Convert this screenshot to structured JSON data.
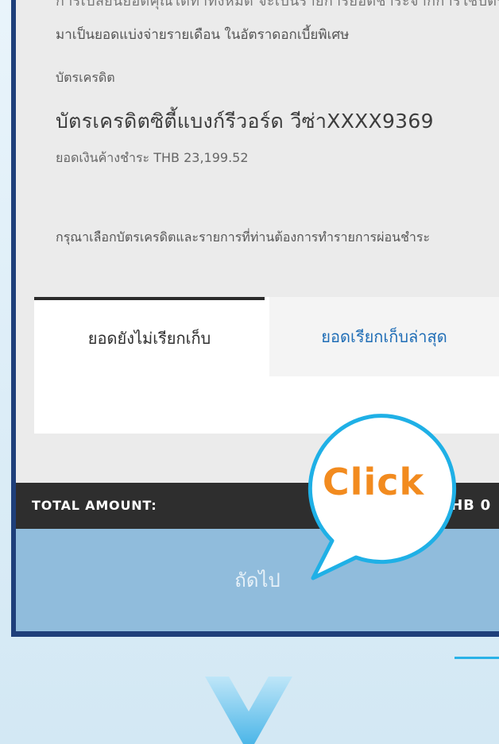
{
  "intro": {
    "cut_line_text": "การเปลี่ยนยอดคุณได้ทำทั้งหมด จะเป็นรายการยอดชำระจากการใช้บัตร",
    "description_text": "มาเป็นยอดแบ่งจ่ายรายเดือน ในอัตราดอกเบี้ยพิเศษ"
  },
  "card_section": {
    "label": "บัตรเครดิต",
    "card_name": "บัตรเครดิตซิตี้แบงก์รีวอร์ด วีซ่าXXXX9369",
    "balance_text": "ยอดเงินค้างชำระ THB 23,199.52"
  },
  "instruction_text": "กรุณาเลือกบัตรเครดิตและรายการที่ท่านต้องการทำรายการผ่อนชำระ",
  "tabs": [
    {
      "label": "ยอดยังไม่เรียกเก็บ",
      "active": true
    },
    {
      "label": "ยอดเรียกเก็บล่าสุด",
      "active": false
    }
  ],
  "total": {
    "label": "TOTAL AMOUNT:",
    "value": "THB 0"
  },
  "next_button": {
    "label": "ถัดไป"
  },
  "callout": {
    "text": "Click"
  },
  "colors": {
    "frame": "#1e3f7a",
    "tab_link": "#1f6db6",
    "total_bar": "#2e2e2e",
    "next_button": "#90bcdc",
    "callout_border": "#1fb0e6",
    "callout_text": "#f28b1f"
  },
  "icons": {
    "decorative_arrow": "chevron-down-icon"
  }
}
